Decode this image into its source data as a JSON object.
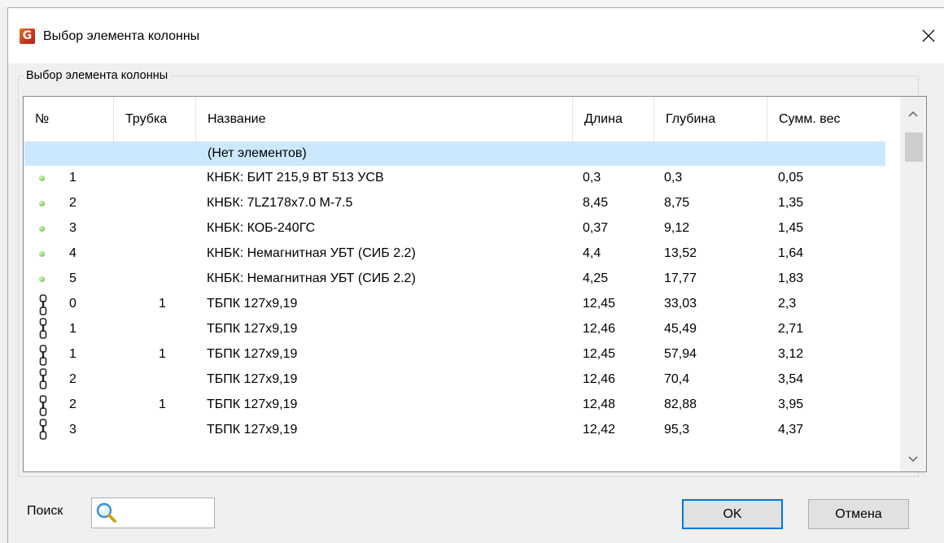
{
  "window": {
    "title": "Выбор элемента колонны",
    "icon_letter": "G",
    "icon": "app-logo-icon",
    "close_icon": "close-icon"
  },
  "group": {
    "label": "Выбор элемента колонны"
  },
  "table": {
    "columns": [
      "№",
      "Трубка",
      "Название",
      "Длина",
      "Глубина",
      "Сумм. вес"
    ],
    "placeholder_row": "(Нет элементов)",
    "rows": [
      {
        "icon": "green-dot",
        "num": "1",
        "pipe": "",
        "name": "КНБК: БИТ 215,9 ВТ 513 УСВ",
        "length": "0,3",
        "depth": "0,3",
        "weight": "0,05"
      },
      {
        "icon": "green-dot",
        "num": "2",
        "pipe": "",
        "name": "КНБК: 7LZ178x7.0 M-7.5",
        "length": "8,45",
        "depth": "8,75",
        "weight": "1,35"
      },
      {
        "icon": "green-dot",
        "num": "3",
        "pipe": "",
        "name": "КНБК: КОБ-240ГС",
        "length": "0,37",
        "depth": "9,12",
        "weight": "1,45"
      },
      {
        "icon": "green-dot",
        "num": "4",
        "pipe": "",
        "name": "КНБК: Немагнитная УБТ (СИБ 2.2)",
        "length": "4,4",
        "depth": "13,52",
        "weight": "1,64"
      },
      {
        "icon": "green-dot",
        "num": "5",
        "pipe": "",
        "name": "КНБК: Немагнитная УБТ (СИБ 2.2)",
        "length": "4,25",
        "depth": "17,77",
        "weight": "1,83"
      },
      {
        "icon": "chain-top",
        "num": "0",
        "pipe": "1",
        "name": "ТБПК 127x9,19",
        "length": "12,45",
        "depth": "33,03",
        "weight": "2,3"
      },
      {
        "icon": "chain-bottom",
        "num": "1",
        "pipe": "",
        "name": "ТБПК 127x9,19",
        "length": "12,46",
        "depth": "45,49",
        "weight": "2,71"
      },
      {
        "icon": "chain-top",
        "num": "1",
        "pipe": "1",
        "name": "ТБПК 127x9,19",
        "length": "12,45",
        "depth": "57,94",
        "weight": "3,12"
      },
      {
        "icon": "chain-bottom",
        "num": "2",
        "pipe": "",
        "name": "ТБПК 127x9,19",
        "length": "12,46",
        "depth": "70,4",
        "weight": "3,54"
      },
      {
        "icon": "chain-top",
        "num": "2",
        "pipe": "1",
        "name": "ТБПК 127x9,19",
        "length": "12,48",
        "depth": "82,88",
        "weight": "3,95"
      },
      {
        "icon": "chain-bottom",
        "num": "3",
        "pipe": "",
        "name": "ТБПК 127x9,19",
        "length": "12,42",
        "depth": "95,3",
        "weight": "4,37"
      }
    ]
  },
  "scrollbar": {
    "up_icon": "chevron-up-icon",
    "down_icon": "chevron-down-icon"
  },
  "search": {
    "label": "Поиск",
    "value": "",
    "placeholder": "",
    "icon": "search-icon"
  },
  "buttons": {
    "ok": "OK",
    "cancel": "Отмена"
  },
  "colors": {
    "selection": "#cce8ff",
    "default_button_border": "#0078d7",
    "icon_orange": "#e0602a",
    "dot_green": "#8fd46b"
  }
}
